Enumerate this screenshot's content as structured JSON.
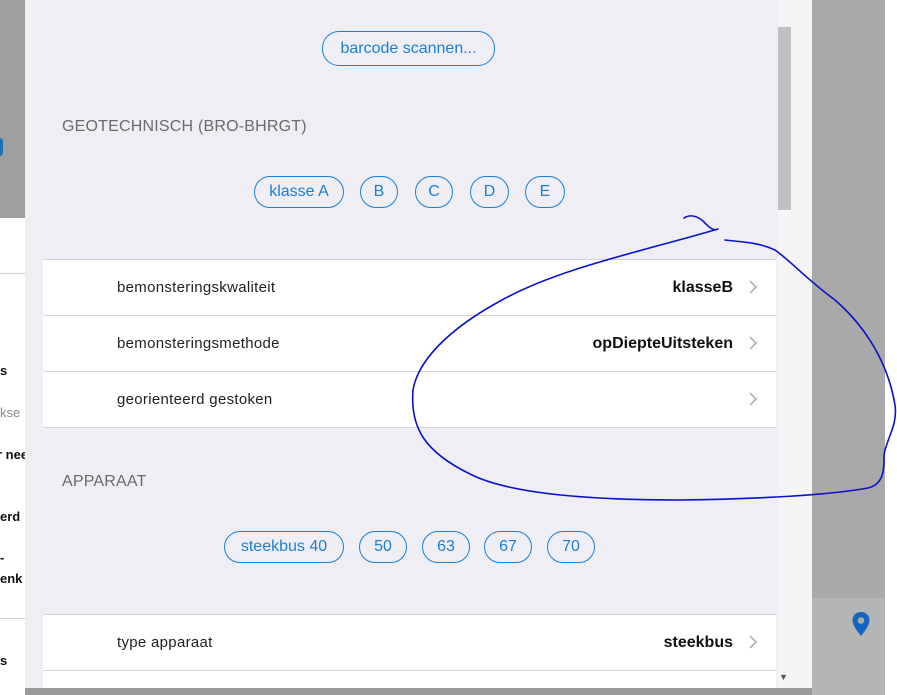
{
  "background": {
    "left_fragments": [
      "s",
      "kse",
      "r nee",
      "erd",
      "-",
      "enk",
      "s"
    ]
  },
  "scan_button": {
    "label": "barcode scannen..."
  },
  "section_geo": {
    "title": "GEOTECHNISCH (BRO-BHRGT)",
    "pills": [
      "klasse A",
      "B",
      "C",
      "D",
      "E"
    ]
  },
  "geo_rows": [
    {
      "label": "bemonsteringskwaliteit",
      "value": "klasseB"
    },
    {
      "label": "bemonsteringsmethode",
      "value": "opDiepteUitsteken"
    },
    {
      "label": "georienteerd gestoken",
      "value": ""
    }
  ],
  "section_apparaat": {
    "title": "APPARAAT",
    "pills": [
      "steekbus 40",
      "50",
      "63",
      "67",
      "70"
    ]
  },
  "apparaat_rows": [
    {
      "label": "type apparaat",
      "value": "steekbus"
    }
  ],
  "colors": {
    "accent": "#1b7fd6",
    "annotation": "#0a12c8",
    "map_pin": "#1565c0"
  },
  "icons": [
    "chevron-right-icon",
    "map-pin-icon",
    "scroll-down-arrow-icon"
  ]
}
